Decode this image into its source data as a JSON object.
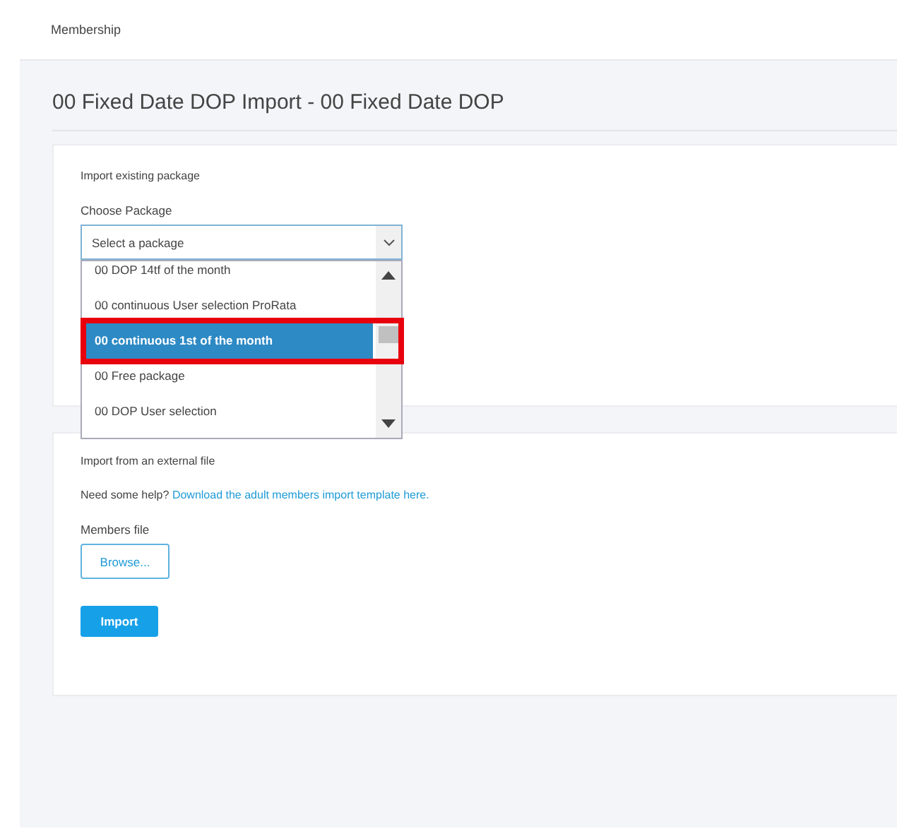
{
  "breadcrumb": "Membership",
  "title": "00 Fixed Date DOP Import - 00 Fixed Date DOP",
  "existing": {
    "heading": "Import existing package",
    "label": "Choose Package",
    "placeholder": "Select a package",
    "expanded": true,
    "options": [
      {
        "label": "00 DOP 14tf of the month",
        "selected": false
      },
      {
        "label": "00 continuous User selection ProRata",
        "selected": false
      },
      {
        "label": "00 continuous 1st of the month",
        "selected": true
      },
      {
        "label": "00 Free package",
        "selected": false
      },
      {
        "label": "00 DOP User selection",
        "selected": false
      }
    ]
  },
  "external": {
    "heading": "Import from an external file",
    "help": "Need some help?",
    "link": "Download the adult members import template here.",
    "file_label": "Members file",
    "browse": "Browse...",
    "import": "Import"
  }
}
